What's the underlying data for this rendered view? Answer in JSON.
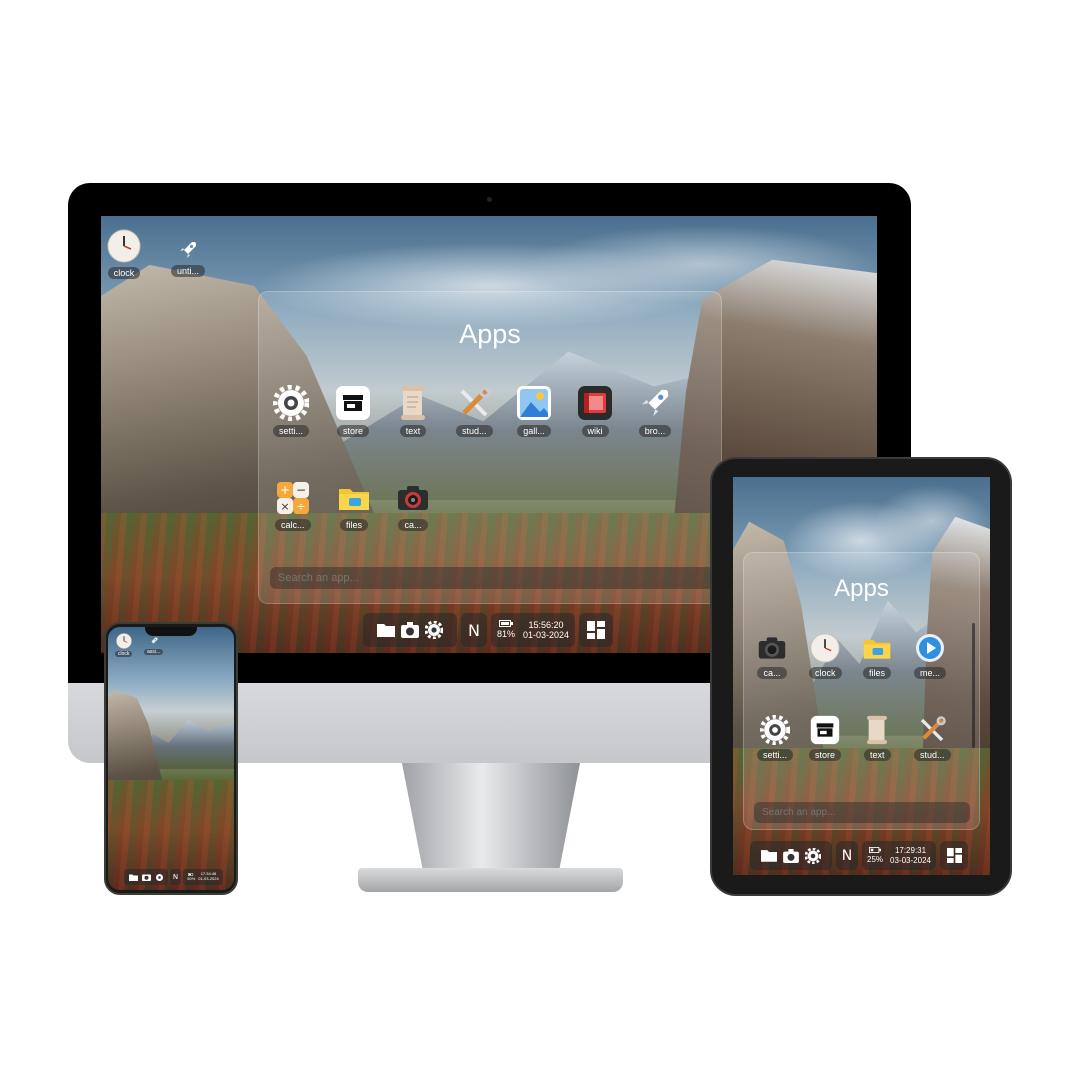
{
  "desktop": {
    "title": "Apps",
    "desktop_icons": [
      {
        "icon": "clock-icon",
        "label": "clock"
      },
      {
        "icon": "rocket-icon",
        "label": "unti..."
      }
    ],
    "apps": [
      {
        "icon": "gear-icon",
        "label": "setti..."
      },
      {
        "icon": "store-icon",
        "label": "store"
      },
      {
        "icon": "scroll-icon",
        "label": "text"
      },
      {
        "icon": "tools-icon",
        "label": "stud..."
      },
      {
        "icon": "gallery-icon",
        "label": "gall..."
      },
      {
        "icon": "wiki-icon",
        "label": "wiki"
      },
      {
        "icon": "rocket-icon",
        "label": "bro..."
      },
      {
        "icon": "calculator-icon",
        "label": "calc..."
      },
      {
        "icon": "folder-icon",
        "label": "files"
      },
      {
        "icon": "camera-icon",
        "label": "ca..."
      }
    ],
    "search_placeholder": "Search an app...",
    "taskbar": {
      "battery": "81%",
      "time": "15:56:20",
      "date": "01-03-2024",
      "n_label": "N"
    }
  },
  "tablet": {
    "title": "Apps",
    "apps": [
      {
        "icon": "camera-icon",
        "label": "ca..."
      },
      {
        "icon": "clock-icon",
        "label": "clock"
      },
      {
        "icon": "folder-icon",
        "label": "files"
      },
      {
        "icon": "play-icon",
        "label": "me..."
      },
      {
        "icon": "gear-icon",
        "label": "setti..."
      },
      {
        "icon": "store-icon",
        "label": "store"
      },
      {
        "icon": "scroll-icon",
        "label": "text"
      },
      {
        "icon": "tools-icon",
        "label": "stud..."
      }
    ],
    "search_placeholder": "Search an app...",
    "taskbar": {
      "battery": "25%",
      "time": "17:29:31",
      "date": "03-03-2024",
      "n_label": "N"
    }
  },
  "phone": {
    "desktop_icons": [
      {
        "icon": "clock-icon",
        "label": "clock"
      },
      {
        "icon": "rocket-icon",
        "label": "assi..."
      }
    ],
    "taskbar": {
      "battery": "50%",
      "time": "17:34:48",
      "date": "01-03-2024",
      "n_label": "N"
    }
  },
  "colors": {
    "glass": "#ffffff24",
    "label_bg": "#282828",
    "accent_blue": "#2f8fe0"
  }
}
